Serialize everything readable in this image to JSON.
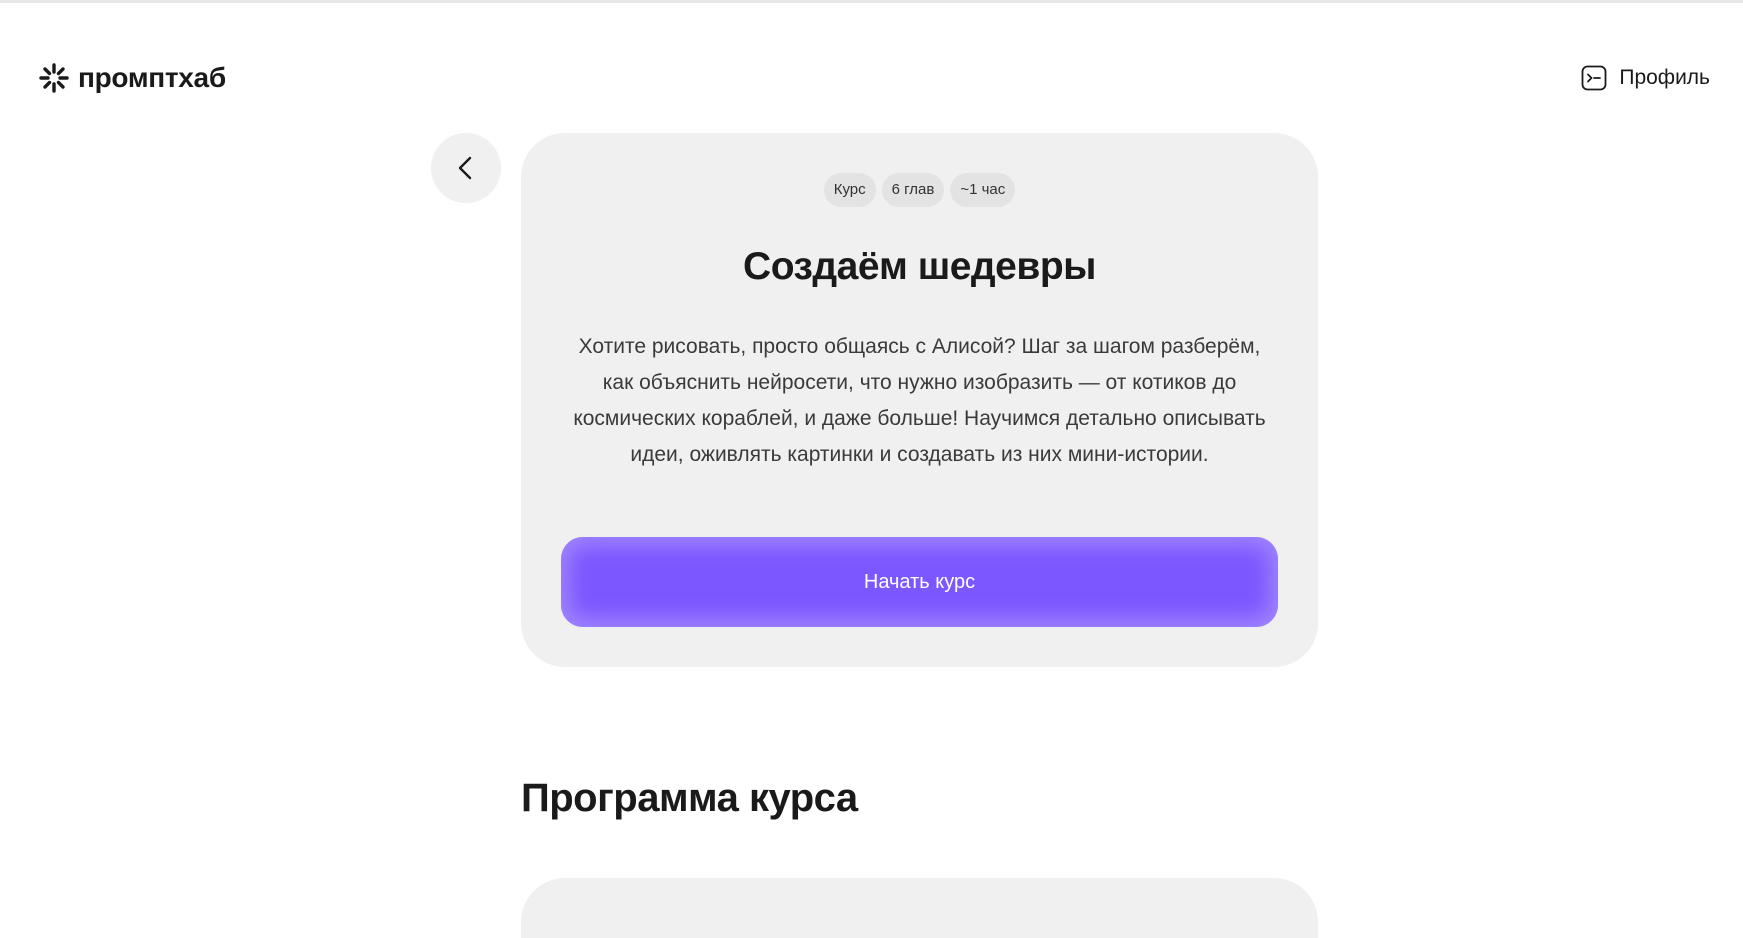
{
  "header": {
    "logo_text": "промптхаб",
    "logo_icon": "sparkle-icon",
    "profile_label": "Профиль",
    "profile_icon": "terminal-icon"
  },
  "course": {
    "back_icon": "chevron-left-icon",
    "chips": [
      "Курс",
      "6 глав",
      "~1 час"
    ],
    "title": "Создаём шедевры",
    "description": "Хотите рисовать, просто общаясь с Алисой? Шаг за шагом разберём, как объяснить нейросети, что нужно изобразить — от котиков до космических кораблей, и даже больше! Научимся детально описывать идеи, оживлять картинки и создавать из них мини-истории.",
    "start_button_label": "Начать курс",
    "accent_color": "#7b57ff"
  },
  "program": {
    "title": "Программа курса"
  }
}
